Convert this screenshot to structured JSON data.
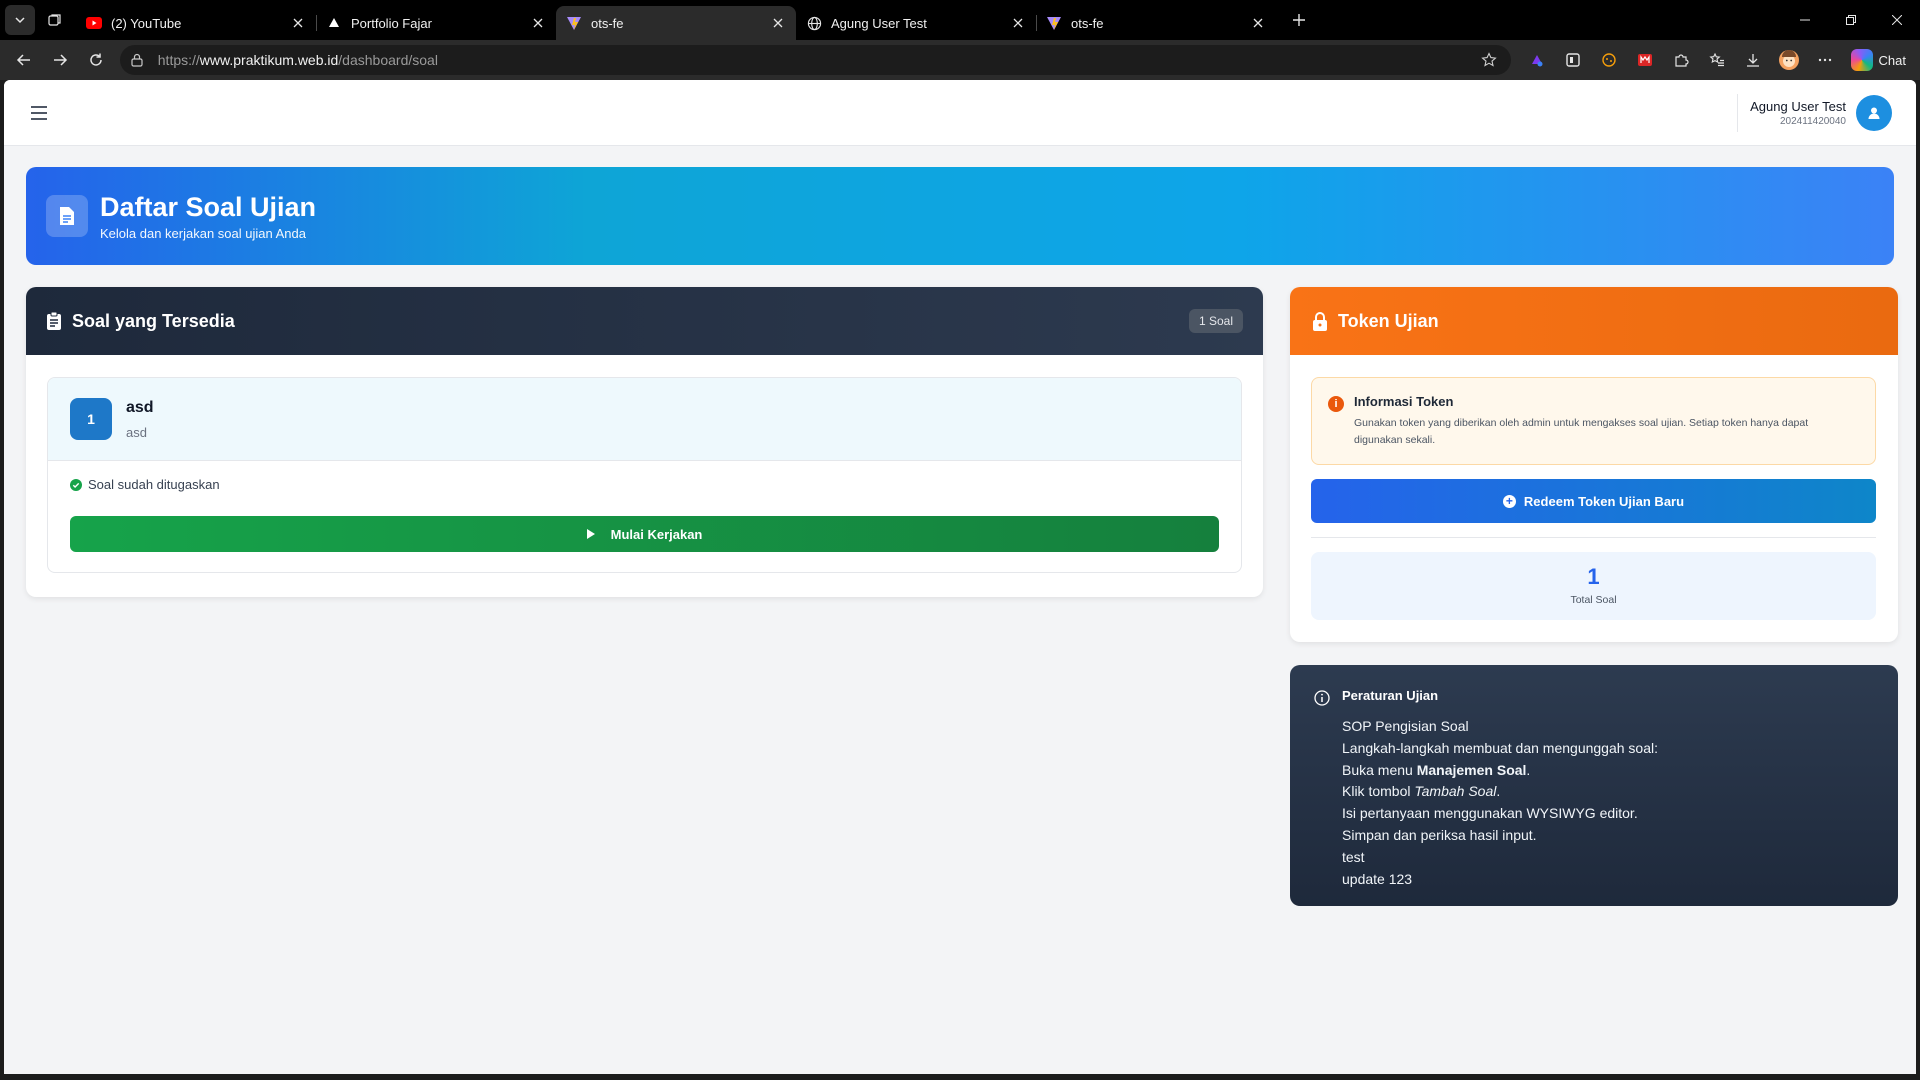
{
  "browser": {
    "tabs": [
      {
        "title": "(2) YouTube",
        "icon": "youtube-icon",
        "active": false
      },
      {
        "title": "Portfolio Fajar",
        "icon": "triangle-logo-icon",
        "active": false
      },
      {
        "title": "ots-fe",
        "icon": "vite-logo-icon",
        "active": true
      },
      {
        "title": "Agung User Test",
        "icon": "globe-icon",
        "active": false
      },
      {
        "title": "ots-fe",
        "icon": "vite-logo-icon",
        "active": false
      }
    ],
    "url_prefix": "https://",
    "url_host": "www.praktikum.web.id",
    "url_path": "/dashboard/soal",
    "chat_label": "Chat"
  },
  "header": {
    "user_name": "Agung User Test",
    "user_id": "202411420040"
  },
  "hero": {
    "title": "Daftar Soal Ujian",
    "subtitle": "Kelola dan kerjakan soal ujian Anda"
  },
  "soal_panel": {
    "title": "Soal yang Tersedia",
    "count_badge": "1 Soal",
    "items": [
      {
        "number": "1",
        "title": "asd",
        "subtitle": "asd",
        "status": "Soal sudah ditugaskan",
        "action_label": "Mulai Kerjakan"
      }
    ]
  },
  "token_panel": {
    "title": "Token Ujian",
    "info_title": "Informasi Token",
    "info_text": "Gunakan token yang diberikan oleh admin untuk mengakses soal ujian. Setiap token hanya dapat digunakan sekali.",
    "redeem_label": "Redeem Token Ujian Baru",
    "total_value": "1",
    "total_label": "Total Soal"
  },
  "rules_panel": {
    "title": "Peraturan Ujian",
    "line1": "SOP Pengisian Soal",
    "line2": "Langkah-langkah membuat dan mengunggah soal:",
    "line3_pre": "Buka menu ",
    "line3_bold": "Manajemen Soal",
    "line3_post": ".",
    "line4_pre": "Klik tombol ",
    "line4_italic": "Tambah Soal",
    "line4_post": ".",
    "line5": "Isi pertanyaan menggunakan WYSIWYG editor.",
    "line6": "Simpan dan periksa hasil input.",
    "line7": "test",
    "line8": "update 123"
  },
  "colors": {
    "hero_gradient_start": "#2563eb",
    "hero_gradient_end": "#3b82f6",
    "dark_header": "#1e293b",
    "token_header": "#f97316",
    "start_button": "#16a34a",
    "redeem_button": "#2563eb"
  }
}
